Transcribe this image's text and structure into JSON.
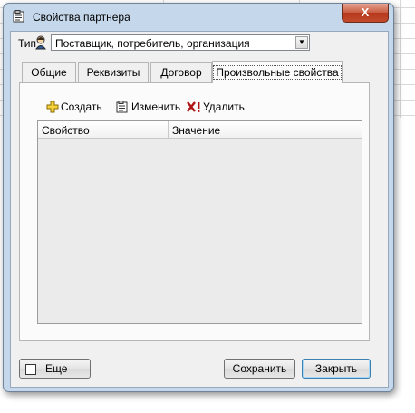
{
  "window": {
    "title": "Свойства партнера",
    "close_label": "X"
  },
  "type": {
    "label": "Тип",
    "value": "Поставщик, потребитель, организация"
  },
  "tabs": [
    {
      "label": "Общие"
    },
    {
      "label": "Реквизиты"
    },
    {
      "label": "Договор"
    },
    {
      "label": "Произвольные свойства",
      "active": true
    }
  ],
  "toolbar": {
    "create_label": "Создать",
    "edit_label": "Изменить",
    "delete_label": "Удалить"
  },
  "grid": {
    "columns": [
      "Свойство",
      "Значение"
    ],
    "rows": []
  },
  "bottom": {
    "more_label": "Еще",
    "save_label": "Сохранить",
    "close_label": "Закрыть"
  },
  "colors": {
    "frame": "#c5d7ea",
    "close_button": "#c24a2c",
    "client_area": "#f0f0f0"
  },
  "icons": [
    "properties-icon",
    "person-icon",
    "plus-icon",
    "edit-icon",
    "delete-icon",
    "dropdown-arrow-icon"
  ]
}
